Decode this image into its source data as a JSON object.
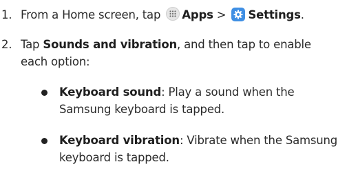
{
  "steps": [
    {
      "number": "1.",
      "prefix": "From a Home screen, tap",
      "apps_label": "Apps",
      "separator": ">",
      "settings_label": "Settings",
      "suffix": ".",
      "icons": [
        "apps-grid-icon",
        "settings-gear-icon"
      ]
    },
    {
      "number": "2.",
      "prefix": "Tap",
      "bold": "Sounds and vibration",
      "line1_suffix": ", and then tap to enable",
      "line2": "each option:"
    }
  ],
  "options": [
    {
      "title": "Keyboard sound",
      "line1_desc": ": Play a sound when the",
      "line2": "Samsung keyboard is tapped."
    },
    {
      "title": "Keyboard vibration",
      "line1_desc": ": Vibrate when the Samsung",
      "line2": "keyboard is tapped."
    }
  ],
  "colors": {
    "settings_icon_bg": "#3f8fe4",
    "text": "#2b2b2b"
  }
}
